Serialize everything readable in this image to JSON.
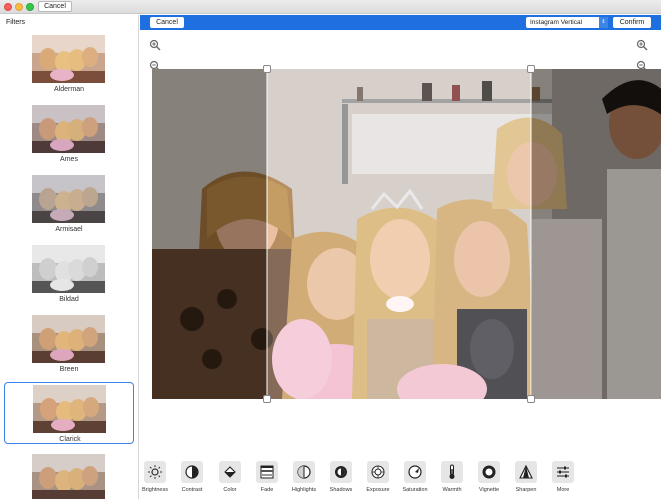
{
  "titlebar": {
    "cancel_label": "Cancel"
  },
  "sidebar": {
    "heading": "Filters",
    "filters": [
      {
        "label": "Alderman",
        "selected": false
      },
      {
        "label": "Ames",
        "selected": false
      },
      {
        "label": "Armisael",
        "selected": false
      },
      {
        "label": "Bildad",
        "selected": false
      },
      {
        "label": "Breen",
        "selected": false
      },
      {
        "label": "Clarick",
        "selected": true
      },
      {
        "label": "",
        "selected": false
      }
    ]
  },
  "toolbar": {
    "cancel_label": "Cancel",
    "aspect_select": "Instagram Vertical",
    "confirm_label": "Confirm"
  },
  "tools": [
    {
      "label": "Brightness",
      "icon": "sun-icon"
    },
    {
      "label": "Contrast",
      "icon": "contrast-icon"
    },
    {
      "label": "Color",
      "icon": "paint-bucket-icon"
    },
    {
      "label": "Fade",
      "icon": "fade-icon"
    },
    {
      "label": "Highlights",
      "icon": "highlights-icon"
    },
    {
      "label": "Shadows",
      "icon": "shadows-icon"
    },
    {
      "label": "Exposure",
      "icon": "exposure-icon"
    },
    {
      "label": "Saturation",
      "icon": "saturation-icon"
    },
    {
      "label": "Warmth",
      "icon": "thermometer-icon"
    },
    {
      "label": "Vignette",
      "icon": "vignette-icon"
    },
    {
      "label": "Sharpen",
      "icon": "sharpen-icon"
    },
    {
      "label": "More",
      "icon": "sliders-icon"
    }
  ],
  "colors": {
    "accent": "#1e6fe0",
    "selection": "#3d84e8"
  }
}
